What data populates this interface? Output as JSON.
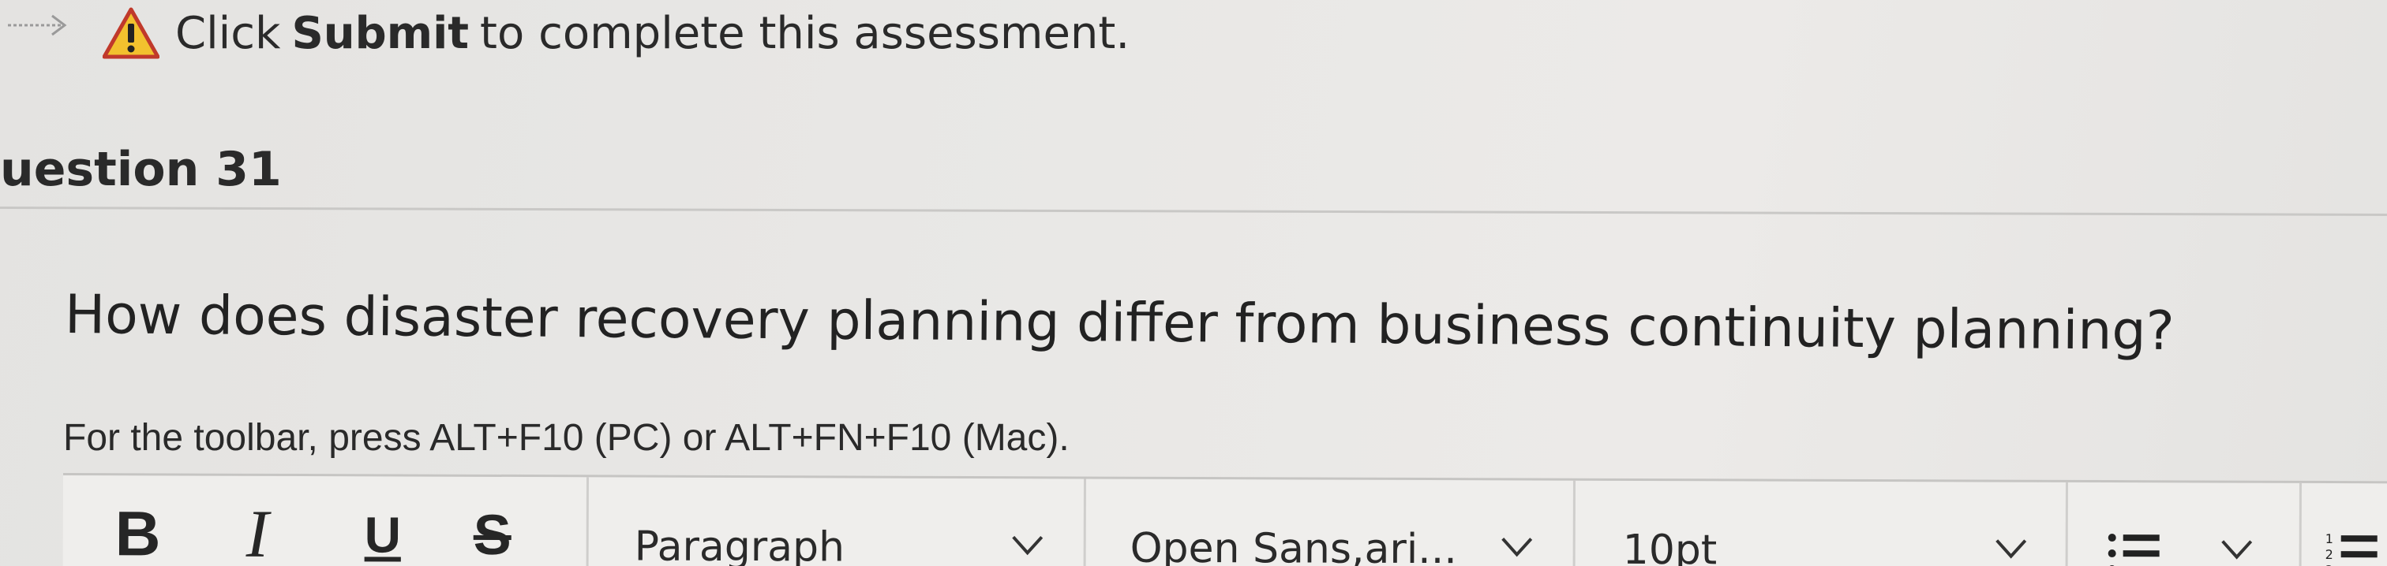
{
  "notice": {
    "prefix": "Click ",
    "emphasis": "Submit",
    "suffix": " to complete this assessment."
  },
  "question": {
    "header": "uestion 31",
    "text": "How does disaster recovery planning differ from business continuity planning?"
  },
  "editor": {
    "toolbar_hint": "For the toolbar, press ALT+F10 (PC) or ALT+FN+F10 (Mac).",
    "bold_label": "B",
    "italic_label": "I",
    "underline_label": "U",
    "strike_label": "S",
    "paragraph_select": "Paragraph",
    "font_select": "Open Sans,ari...",
    "size_select": "10pt"
  },
  "icons": {
    "arrow": "arrow-right-icon",
    "warning": "warning-icon",
    "bullet_list": "bullet-list-icon",
    "numbered_list": "numbered-list-icon",
    "chevron": "chevron-down-icon"
  },
  "colors": {
    "warning_fill": "#f2c12e",
    "warning_outline": "#c0392b",
    "text": "#262626"
  }
}
